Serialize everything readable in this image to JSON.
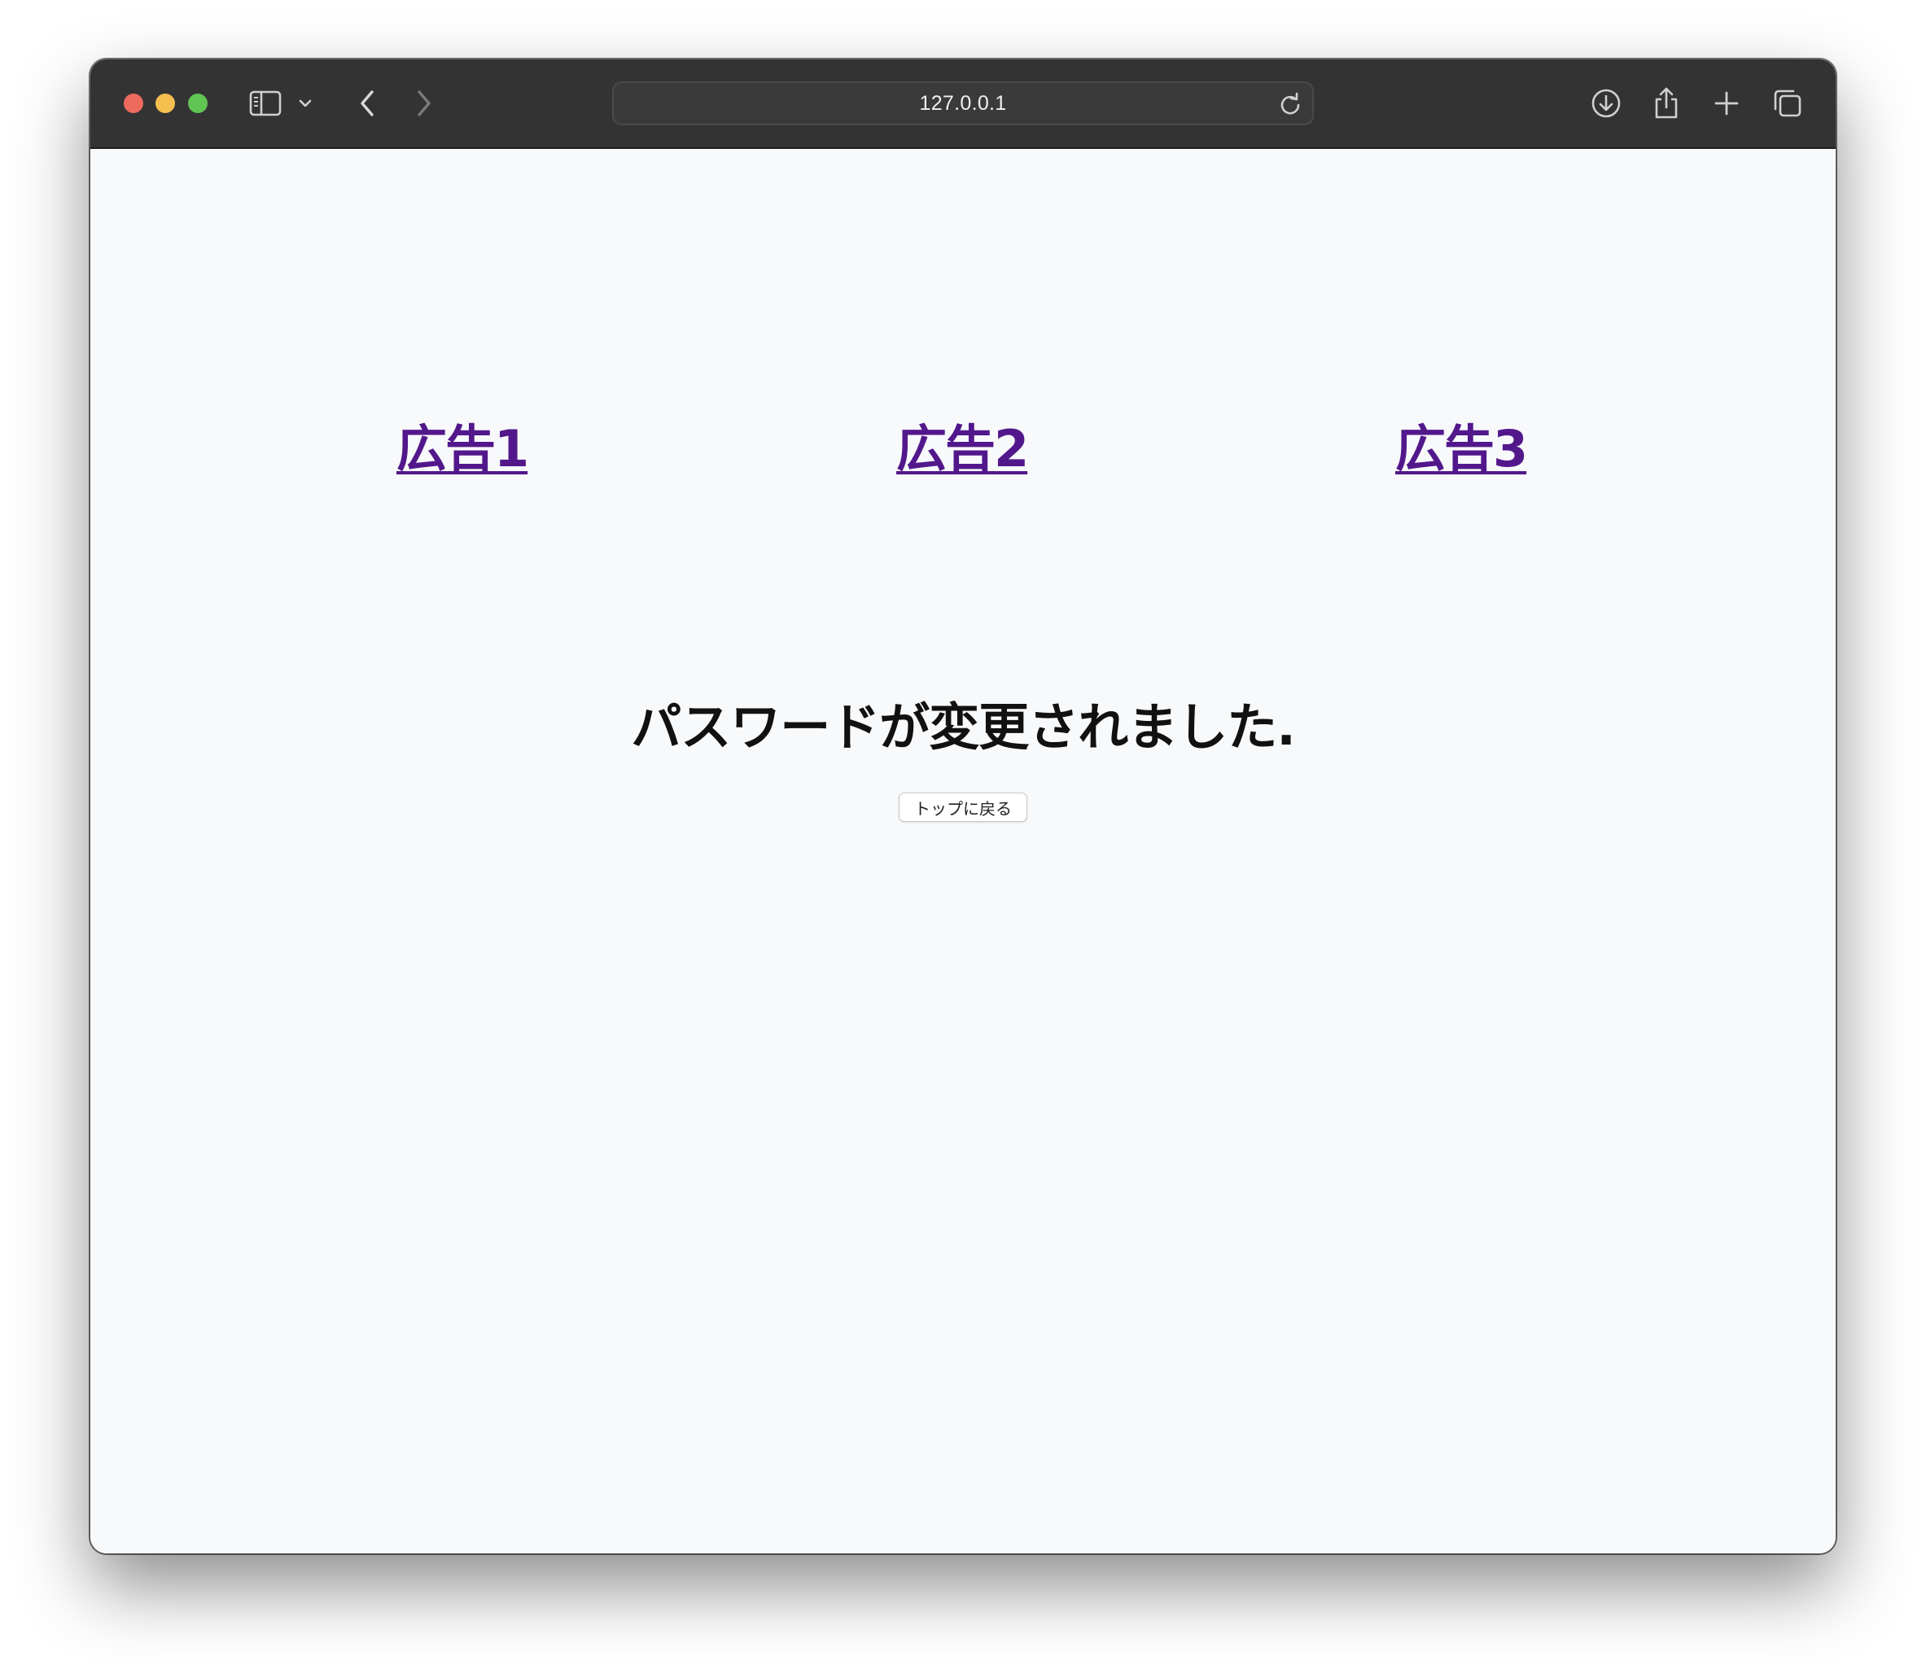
{
  "browser": {
    "url": "127.0.0.1",
    "icons": {
      "sidebar": "sidebar-icon",
      "chevron": "chevron-down-icon",
      "back": "back-arrow-icon",
      "forward": "forward-arrow-icon",
      "reload": "reload-icon",
      "download": "download-icon",
      "share": "share-icon",
      "new_tab": "plus-icon",
      "tabs": "tabs-overview-icon"
    }
  },
  "ads": [
    {
      "label": "広告1"
    },
    {
      "label": "広告2"
    },
    {
      "label": "広告3"
    }
  ],
  "message": {
    "headline": "パスワードが変更されました.",
    "button_label": "トップに戻る"
  },
  "colors": {
    "link": "#52188b",
    "toolbar": "#333333",
    "page_background": "#f8f9fb"
  }
}
